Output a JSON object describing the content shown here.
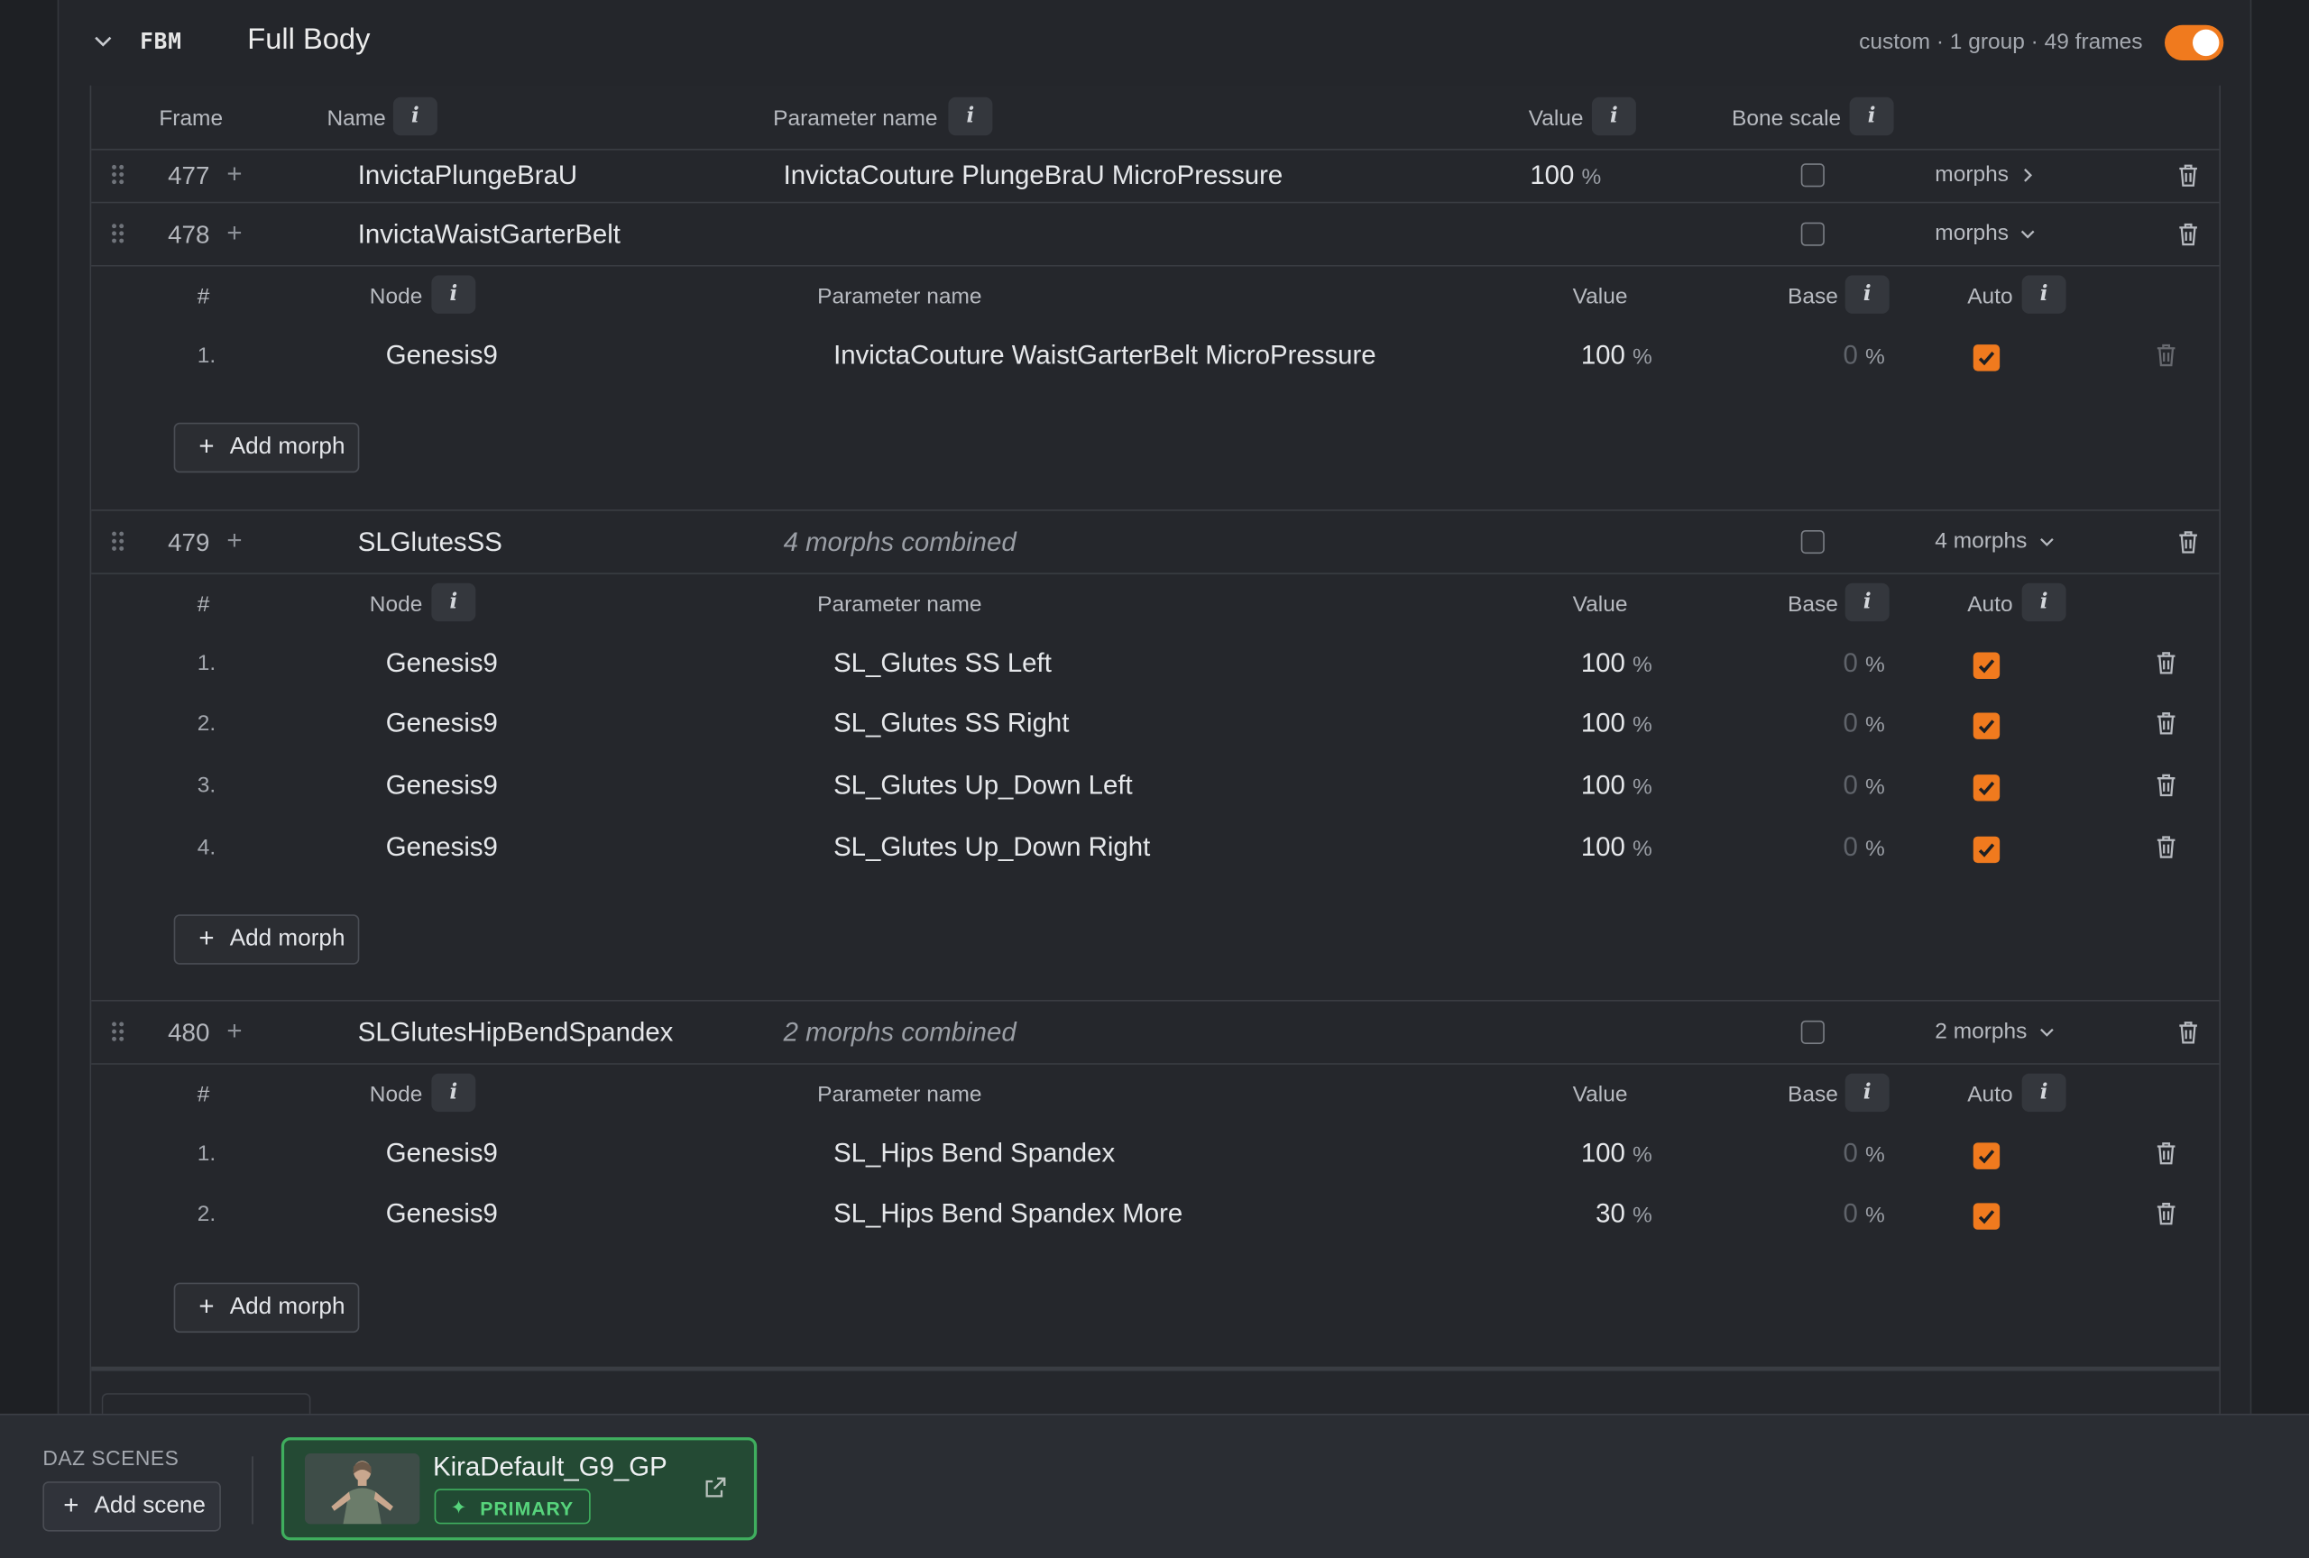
{
  "section": {
    "code": "FBM",
    "title": "Full Body",
    "meta": "custom · 1 group · 49 frames",
    "enabled": true
  },
  "columns": {
    "frame": "Frame",
    "name": "Name",
    "parameter_name": "Parameter name",
    "value": "Value",
    "bone_scale": "Bone scale"
  },
  "sub_columns": {
    "num": "#",
    "node": "Node",
    "parameter_name": "Parameter name",
    "value": "Value",
    "base": "Base",
    "auto": "Auto"
  },
  "icons": {
    "info": "i",
    "percent": "%",
    "plus": "+",
    "add_morph_label": "Add morph"
  },
  "frames": [
    {
      "num": "477",
      "name": "InvictaPlungeBraU",
      "param": "InvictaCouture PlungeBraU MicroPressure",
      "value": "100",
      "morphs_label": "morphs",
      "expanded": false
    },
    {
      "num": "478",
      "name": "InvictaWaistGarterBelt",
      "param": "",
      "value": "",
      "morphs_label": "morphs",
      "expanded": true,
      "morphs": [
        {
          "num": "1.",
          "node": "Genesis9",
          "param": "InvictaCouture WaistGarterBelt MicroPressure",
          "value": "100",
          "base": "0",
          "auto": true
        }
      ]
    },
    {
      "num": "479",
      "name": "SLGlutesSS",
      "param": "4 morphs combined",
      "value": "",
      "morphs_label": "4 morphs",
      "expanded": true,
      "morphs": [
        {
          "num": "1.",
          "node": "Genesis9",
          "param": "SL_Glutes SS Left",
          "value": "100",
          "base": "0",
          "auto": true
        },
        {
          "num": "2.",
          "node": "Genesis9",
          "param": "SL_Glutes SS Right",
          "value": "100",
          "base": "0",
          "auto": true
        },
        {
          "num": "3.",
          "node": "Genesis9",
          "param": "SL_Glutes Up_Down Left",
          "value": "100",
          "base": "0",
          "auto": true
        },
        {
          "num": "4.",
          "node": "Genesis9",
          "param": "SL_Glutes Up_Down Right",
          "value": "100",
          "base": "0",
          "auto": true
        }
      ]
    },
    {
      "num": "480",
      "name": "SLGlutesHipBendSpandex",
      "param": "2 morphs combined",
      "value": "",
      "morphs_label": "2 morphs",
      "expanded": true,
      "morphs": [
        {
          "num": "1.",
          "node": "Genesis9",
          "param": "SL_Hips Bend Spandex",
          "value": "100",
          "base": "0",
          "auto": true
        },
        {
          "num": "2.",
          "node": "Genesis9",
          "param": "SL_Hips Bend Spandex More",
          "value": "30",
          "base": "0",
          "auto": true
        }
      ]
    }
  ],
  "dock": {
    "label": "DAZ SCENES",
    "add_scene": "Add scene",
    "scene": {
      "name": "KiraDefault_G9_GP",
      "badge": "PRIMARY"
    }
  },
  "colors": {
    "accent": "#f07a1e",
    "primary_green": "#3fae5e",
    "background": "#1e2024"
  }
}
